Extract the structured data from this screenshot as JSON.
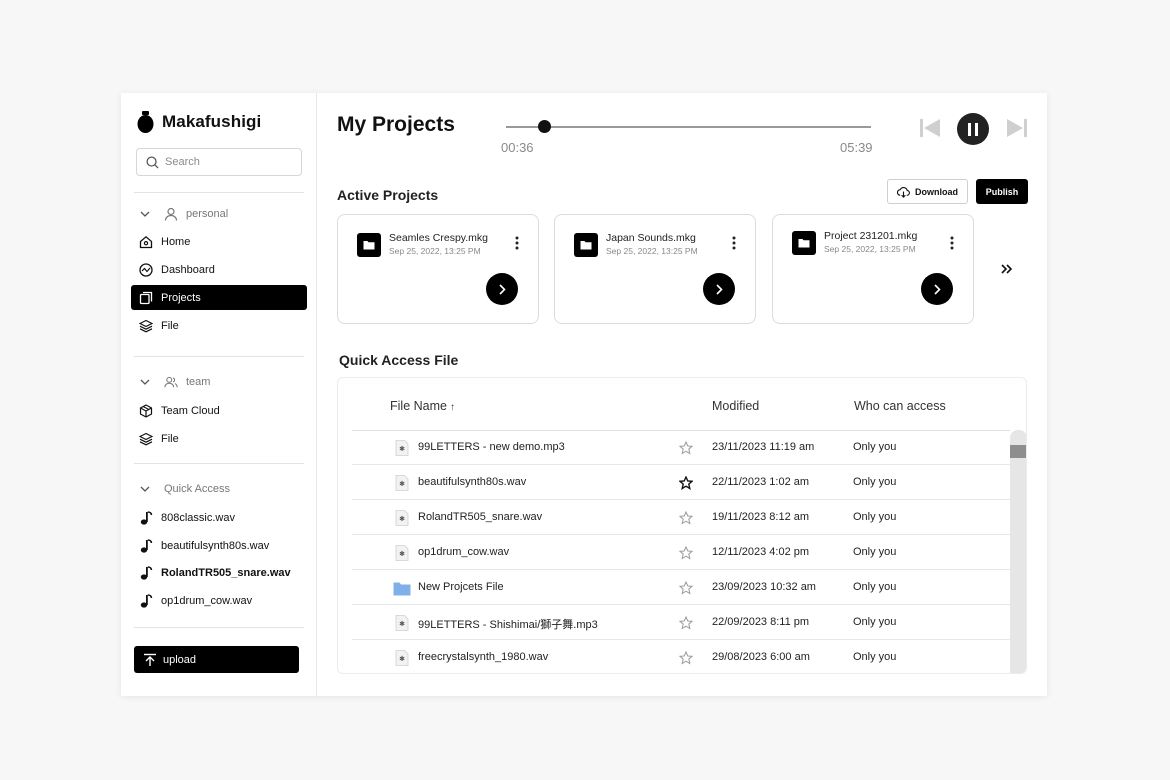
{
  "app": {
    "name": "Makafushigi"
  },
  "search": {
    "placeholder": "Search"
  },
  "sidebar": {
    "personal": {
      "label": "personal",
      "items": [
        {
          "label": "Home",
          "icon": "home-icon"
        },
        {
          "label": "Dashboard",
          "icon": "dashboard-icon"
        },
        {
          "label": "Projects",
          "icon": "projects-icon",
          "active": true
        },
        {
          "label": "File",
          "icon": "layers-icon"
        }
      ]
    },
    "team": {
      "label": "team",
      "items": [
        {
          "label": "Team Cloud",
          "icon": "cube-icon"
        },
        {
          "label": "File",
          "icon": "layers-icon"
        }
      ]
    },
    "quick_access": {
      "label": "Quick Access",
      "items": [
        {
          "label": "808classic.wav",
          "icon": "music-note-icon"
        },
        {
          "label": "beautifulsynth80s.wav",
          "icon": "music-note-icon"
        },
        {
          "label": "RolandTR505_snare.wav",
          "icon": "music-note-icon",
          "bold": true
        },
        {
          "label": "op1drum_cow.wav",
          "icon": "music-note-icon"
        }
      ]
    },
    "upload_label": "upload"
  },
  "header": {
    "title": "My Projects"
  },
  "player": {
    "elapsed": "00:36",
    "duration": "05:39",
    "progress": 0.106
  },
  "active_projects": {
    "title": "Active Projects",
    "download_label": "Download",
    "publish_label": "Publish",
    "cards": [
      {
        "name": "Seamles Crespy.mkg",
        "date": "Sep 25, 2022, 13:25 PM"
      },
      {
        "name": "Japan Sounds.mkg",
        "date": "Sep 25, 2022, 13:25 PM"
      },
      {
        "name": "Project 231201.mkg",
        "date": "Sep 25, 2022, 13:25 PM"
      }
    ]
  },
  "quick_access_file": {
    "title": "Quick Access File",
    "columns": {
      "name": "File Name",
      "modified": "Modified",
      "access": "Who can access"
    },
    "sort_indicator": "↑",
    "rows": [
      {
        "name": "99LETTERS - new demo.mp3",
        "modified": "23/11/2023 11:19 am",
        "access": "Only you",
        "type": "audio",
        "starred": false
      },
      {
        "name": "beautifulsynth80s.wav",
        "modified": "22/11/2023 1:02 am",
        "access": "Only you",
        "type": "audio",
        "starred": true
      },
      {
        "name": "RolandTR505_snare.wav",
        "modified": "19/11/2023 8:12 am",
        "access": "Only you",
        "type": "audio",
        "starred": false
      },
      {
        "name": "op1drum_cow.wav",
        "modified": "12/11/2023 4:02 pm",
        "access": "Only you",
        "type": "audio",
        "starred": false
      },
      {
        "name": "New Projcets File",
        "modified": "23/09/2023 10:32 am",
        "access": "Only you",
        "type": "folder",
        "starred": false
      },
      {
        "name": "99LETTERS - Shishimai/獅子舞.mp3",
        "modified": "22/09/2023 8:11 pm",
        "access": "Only you",
        "type": "audio",
        "starred": false
      },
      {
        "name": "freecrystalsynth_1980.wav",
        "modified": "29/08/2023 6:00 am",
        "access": "Only you",
        "type": "audio",
        "starred": false
      }
    ]
  },
  "colors": {
    "accent": "#000000",
    "folder": "#7fb0e8",
    "muted_text": "#888888"
  }
}
